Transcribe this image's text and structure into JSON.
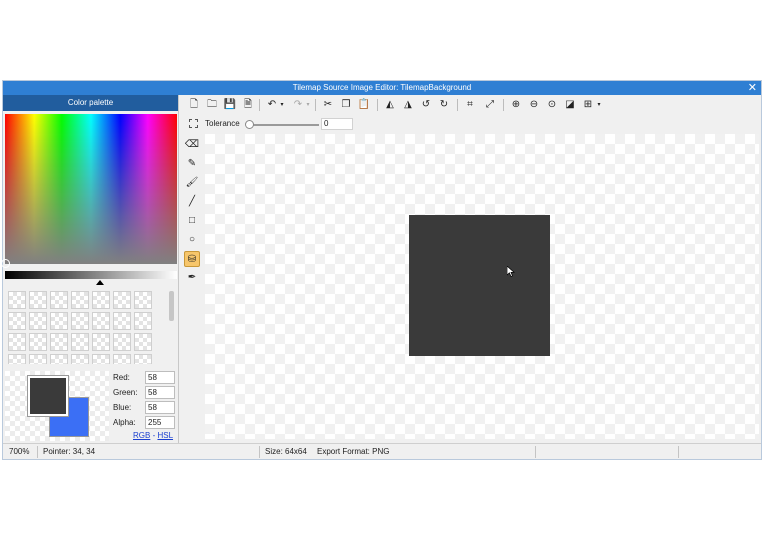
{
  "window": {
    "title": "Tilemap Source Image Editor: TilemapBackground",
    "close_label": "✕"
  },
  "palette": {
    "header": "Color palette",
    "foreground_color": "#3a3a3a",
    "background_color": "#3b6ff5",
    "red_label": "Red:",
    "red_value": "58",
    "green_label": "Green:",
    "green_value": "58",
    "blue_label": "Blue:",
    "blue_value": "58",
    "alpha_label": "Alpha:",
    "alpha_value": "255",
    "rgb_link": "RGB",
    "mode_sep": " - ",
    "hsl_link": "HSL"
  },
  "toolbar": {
    "icons": [
      "new-file-icon",
      "open-folder-icon",
      "save-icon",
      "save-as-icon",
      "undo-icon",
      "undo-dropdown-icon",
      "redo-icon",
      "redo-dropdown-icon",
      "cut-icon",
      "copy-icon",
      "paste-icon",
      "flip-horizontal-icon",
      "flip-vertical-icon",
      "rotate-left-icon",
      "rotate-right-icon",
      "crop-icon",
      "resize-icon",
      "zoom-in-icon",
      "zoom-out-icon",
      "zoom-actual-icon",
      "invert-icon",
      "grid-icon",
      "grid-dropdown-icon"
    ]
  },
  "options": {
    "tolerance_label": "Tolerance",
    "tolerance_value": "0",
    "tolerance_level": 0
  },
  "tools": [
    "eraser-icon",
    "pencil-icon",
    "brush-icon",
    "line-icon",
    "rectangle-icon",
    "ellipse-icon",
    "fill-bucket-icon",
    "eyedropper-icon"
  ],
  "active_tool": "fill-bucket-icon",
  "canvas": {
    "image_color": "#3a3a3a"
  },
  "status": {
    "zoom": "700%",
    "pointer": "Pointer: 34, 34",
    "size": "Size: 64x64",
    "export_format": "Export Format: PNG"
  }
}
